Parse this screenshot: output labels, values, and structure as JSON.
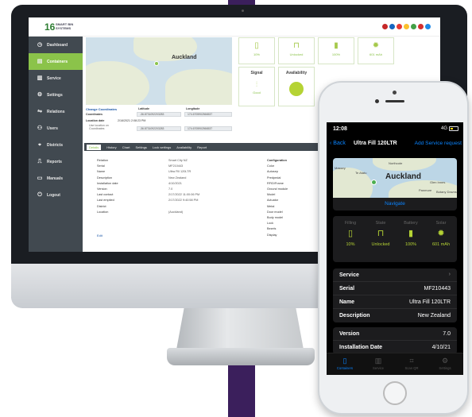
{
  "app": {
    "logo_mark": "16",
    "logo_text": "SMART BIN SYSTEMS",
    "flags": [
      "#c62828",
      "#1565c0",
      "#e53935",
      "#fbc02d",
      "#43a047",
      "#d32f2f",
      "#1e88e5"
    ]
  },
  "sidebar": {
    "items": [
      {
        "label": "Dashboard",
        "icon": "clock-icon"
      },
      {
        "label": "Containers",
        "icon": "container-icon"
      },
      {
        "label": "Service",
        "icon": "bar-chart-icon"
      },
      {
        "label": "Settings",
        "icon": "gear-icon"
      },
      {
        "label": "Relations",
        "icon": "handshake-icon"
      },
      {
        "label": "Users",
        "icon": "users-icon"
      },
      {
        "label": "Districts",
        "icon": "map-pin-icon"
      },
      {
        "label": "Reports",
        "icon": "chart-icon"
      },
      {
        "label": "Manuals",
        "icon": "book-icon"
      },
      {
        "label": "Logout",
        "icon": "logout-icon"
      }
    ]
  },
  "dashboard": {
    "map_city": "Auckland",
    "tiles": [
      {
        "value": "10%",
        "icon": "bin-icon"
      },
      {
        "value": "Unlocked",
        "icon": "lock-icon"
      },
      {
        "value": "100%",
        "icon": "battery-icon"
      },
      {
        "value": "601 mAh",
        "icon": "sun-icon"
      }
    ],
    "signal_title": "Signal",
    "signal_value": "Good",
    "availability_title": "Availability",
    "coords": {
      "change_label": "Change Coordinates",
      "latitude_header": "Latitude",
      "longitude_header": "Longitude",
      "coordinates_label": "Coordinates",
      "lat_value": "-36.8731092203283",
      "lng_value": "174.6705902566537",
      "location_date_label": "Location date",
      "location_date_value": "2/16/2021 2:08:23 PM",
      "sub_label": "Use location on Coordinates",
      "lat_value2": "-36.8731092203283",
      "lng_value2": "174.6705902566537"
    },
    "tabs": [
      "Details",
      "History",
      "Chart",
      "Settings",
      "Lock settings",
      "Availability",
      "Report"
    ],
    "details": [
      {
        "k": "Relation",
        "v": "Smart City NZ"
      },
      {
        "k": "Serial",
        "v": "MF210443"
      },
      {
        "k": "Name",
        "v": "Ultra Fill 120LTR"
      },
      {
        "k": "Description",
        "v": "New Zealand"
      },
      {
        "k": "Installation date",
        "v": "4/10/2021"
      },
      {
        "k": "Version",
        "v": "7.0"
      },
      {
        "k": "Last contact",
        "v": "2/17/2022 11:00:06 PM"
      },
      {
        "k": "Last emptied",
        "v": "2/17/2022 9:40:58 PM"
      },
      {
        "k": "District",
        "v": ""
      },
      {
        "k": "Location",
        "v": "(Auckland)"
      }
    ],
    "config": [
      "Configuration",
      "Color",
      "Autosep",
      "Predpedal",
      "RFID/Frame",
      "Ground module",
      "Model",
      "Actuator",
      "Metal",
      "Door model",
      "Body model",
      "Lock",
      "Bezels",
      "Display"
    ],
    "edit_label": "Edit"
  },
  "phone": {
    "time": "12:08",
    "network": "4G",
    "back": "Back",
    "title": "Ultra Fill 120LTR",
    "request": "Add Service request",
    "map_city": "Auckland",
    "map_labels": [
      "Massey",
      "Te Atatu",
      "Northcote",
      "Glen Innes",
      "Panmure",
      "Botany Downs"
    ],
    "navigate": "Navigate",
    "stats": [
      {
        "header": "Filling",
        "value": "10%",
        "icon": "bin-icon"
      },
      {
        "header": "State",
        "value": "Unlocked",
        "icon": "lock-icon"
      },
      {
        "header": "Battery",
        "value": "100%",
        "icon": "battery-icon"
      },
      {
        "header": "Solar",
        "value": "601 mAh",
        "icon": "sun-icon"
      }
    ],
    "list1": [
      {
        "k": "Service",
        "v": "",
        "chev": true
      },
      {
        "k": "Serial",
        "v": "MF210443"
      },
      {
        "k": "Name",
        "v": "Ultra Fill 120LTR"
      },
      {
        "k": "Description",
        "v": "New Zealand"
      }
    ],
    "list2": [
      {
        "k": "Version",
        "v": "7.0"
      },
      {
        "k": "Installation Date",
        "v": "4/10/21"
      }
    ],
    "tabbar": [
      {
        "label": "Containers",
        "icon": "bin-icon"
      },
      {
        "label": "Service",
        "icon": "chart-icon"
      },
      {
        "label": "Scan QR",
        "icon": "qr-icon"
      },
      {
        "label": "Settings",
        "icon": "gear-icon"
      }
    ]
  }
}
